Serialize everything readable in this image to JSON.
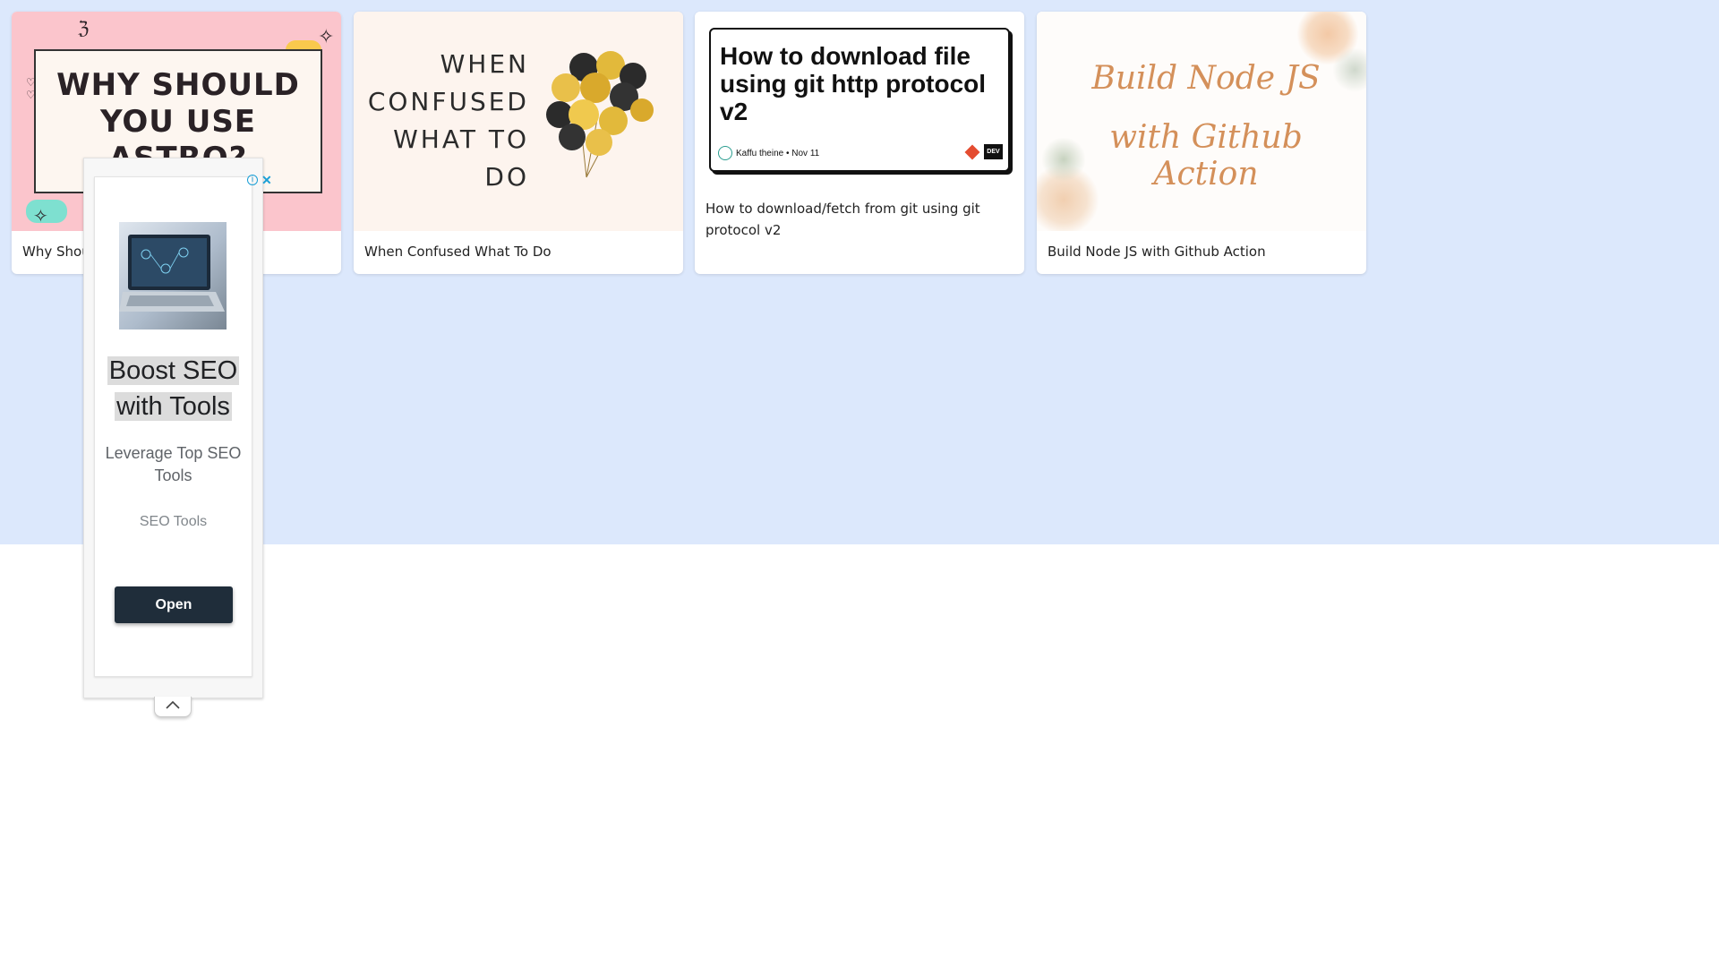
{
  "cards": [
    {
      "thumb_title": "WHY SHOULD YOU USE ASTRO?",
      "caption": "Why Should You Use Astro?"
    },
    {
      "thumb_lines": [
        "WHEN",
        "CONFUSED",
        "WHAT TO",
        "DO"
      ],
      "caption": "When Confused What To Do"
    },
    {
      "thumb_title": "How to download file using git http protocol v2",
      "thumb_author": "Kaffu theine • Nov 11",
      "thumb_badge": "DEV",
      "caption": "How to download/fetch from git using git protocol v2"
    },
    {
      "thumb_line1": "Build Node JS",
      "thumb_line2": "with Github Action",
      "caption": "Build Node JS with Github Action"
    }
  ],
  "ad": {
    "headline_line1": "Boost SEO",
    "headline_line2": "with Tools",
    "description": "Leverage Top SEO Tools",
    "sponsor": "SEO Tools",
    "button_label": "Open",
    "choices_icon": "adchoices-icon",
    "close_icon": "close-icon",
    "collapse_icon": "chevron-up-icon"
  },
  "colors": {
    "band": "#dce8fc",
    "button": "#1f2d3a",
    "astro_bg": "#fbc5cc",
    "node_text": "#d4905a"
  }
}
